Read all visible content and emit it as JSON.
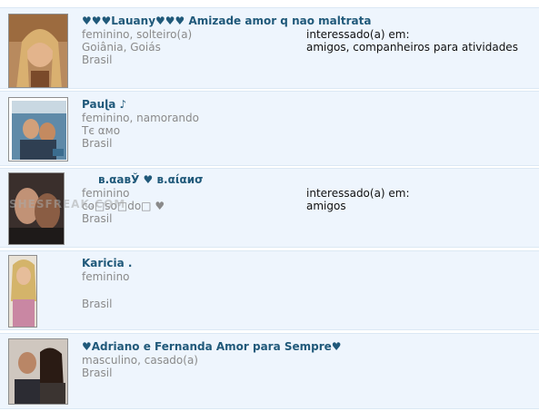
{
  "profiles": [
    {
      "name": "♥♥♥Lauany♥♥♥ Amizade amor q nao maltrata",
      "line1": "feminino, solteiro(a)",
      "line2": "Goiânia, Goiás",
      "line3": "Brasil",
      "interest_label": "interessado(a) em:",
      "interest_value": "amigos, companheiros para atividades"
    },
    {
      "name": "Pauɭa ♪",
      "line1": "feminino, namorando",
      "line2": "Tє αмo",
      "line3": "Brasil"
    },
    {
      "name": "в.αавЎ   ♥   в.αίαиσ",
      "line1": "feminino",
      "line2": "co□so□do□ ♥",
      "line3": "Brasil",
      "interest_label": "interessado(a) em:",
      "interest_value": "amigos"
    },
    {
      "name": "Karicia .",
      "line1": "feminino",
      "line3": "Brasil"
    },
    {
      "name": "♥Adriano e Fernanda Amor para Sempre♥",
      "line1": "masculino, casado(a)",
      "line3": "Brasil"
    }
  ],
  "watermark": "SHESFREAK.COM"
}
